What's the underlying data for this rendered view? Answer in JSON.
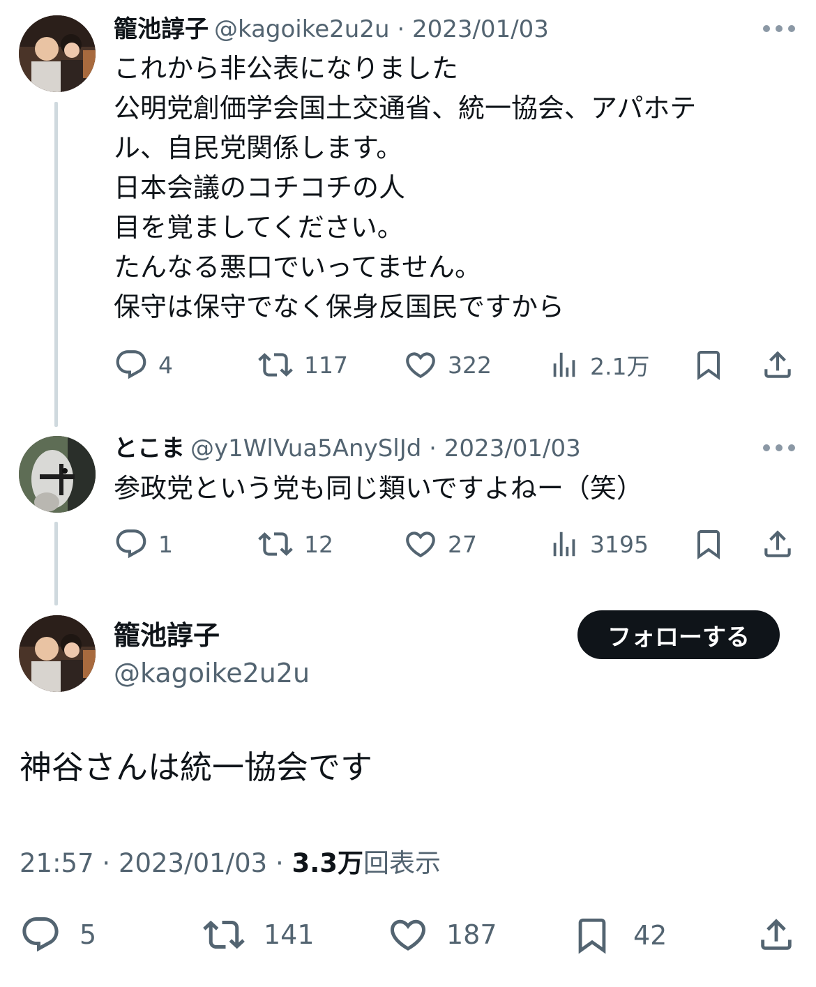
{
  "tweet1": {
    "name": "籠池諄子",
    "handle": "@kagoike2u2u",
    "sep": "·",
    "date": "2023/01/03",
    "lines": [
      "これから非公表になりました",
      "公明党創価学会国土交通省、統一協会、アパホテ",
      "ル、自民党関係します。",
      "日本会議のコチコチの人",
      "目を覚ましてください。",
      "たんなる悪口でいってません。",
      "保守は保守でなく保身反国民ですから"
    ],
    "replies": "4",
    "retweets": "117",
    "likes": "322",
    "views": "2.1万"
  },
  "tweet2": {
    "name": "とこま",
    "handle": "@y1WlVua5AnySlJd",
    "sep": "·",
    "date": "2023/01/03",
    "text": "参政党という党も同じ類いですよねー（笑）",
    "replies": "1",
    "retweets": "12",
    "likes": "27",
    "views": "3195"
  },
  "main": {
    "name": "籠池諄子",
    "handle": "@kagoike2u2u",
    "follow_label": "フォローする",
    "text": "神谷さんは統一協会です",
    "time": "21:57",
    "sep": "·",
    "date": "2023/01/03",
    "views_count": "3.3万",
    "views_label": "回表示",
    "replies": "5",
    "retweets": "141",
    "likes": "187",
    "bookmarks": "42"
  },
  "icons": [
    "more-icon",
    "reply-icon",
    "retweet-icon",
    "like-icon",
    "views-icon",
    "bookmark-icon",
    "share-icon"
  ],
  "colors": {
    "text": "#0f1419",
    "secondary": "#536471",
    "thread_line": "#cfd9de",
    "follow_bg": "#0f1419"
  }
}
